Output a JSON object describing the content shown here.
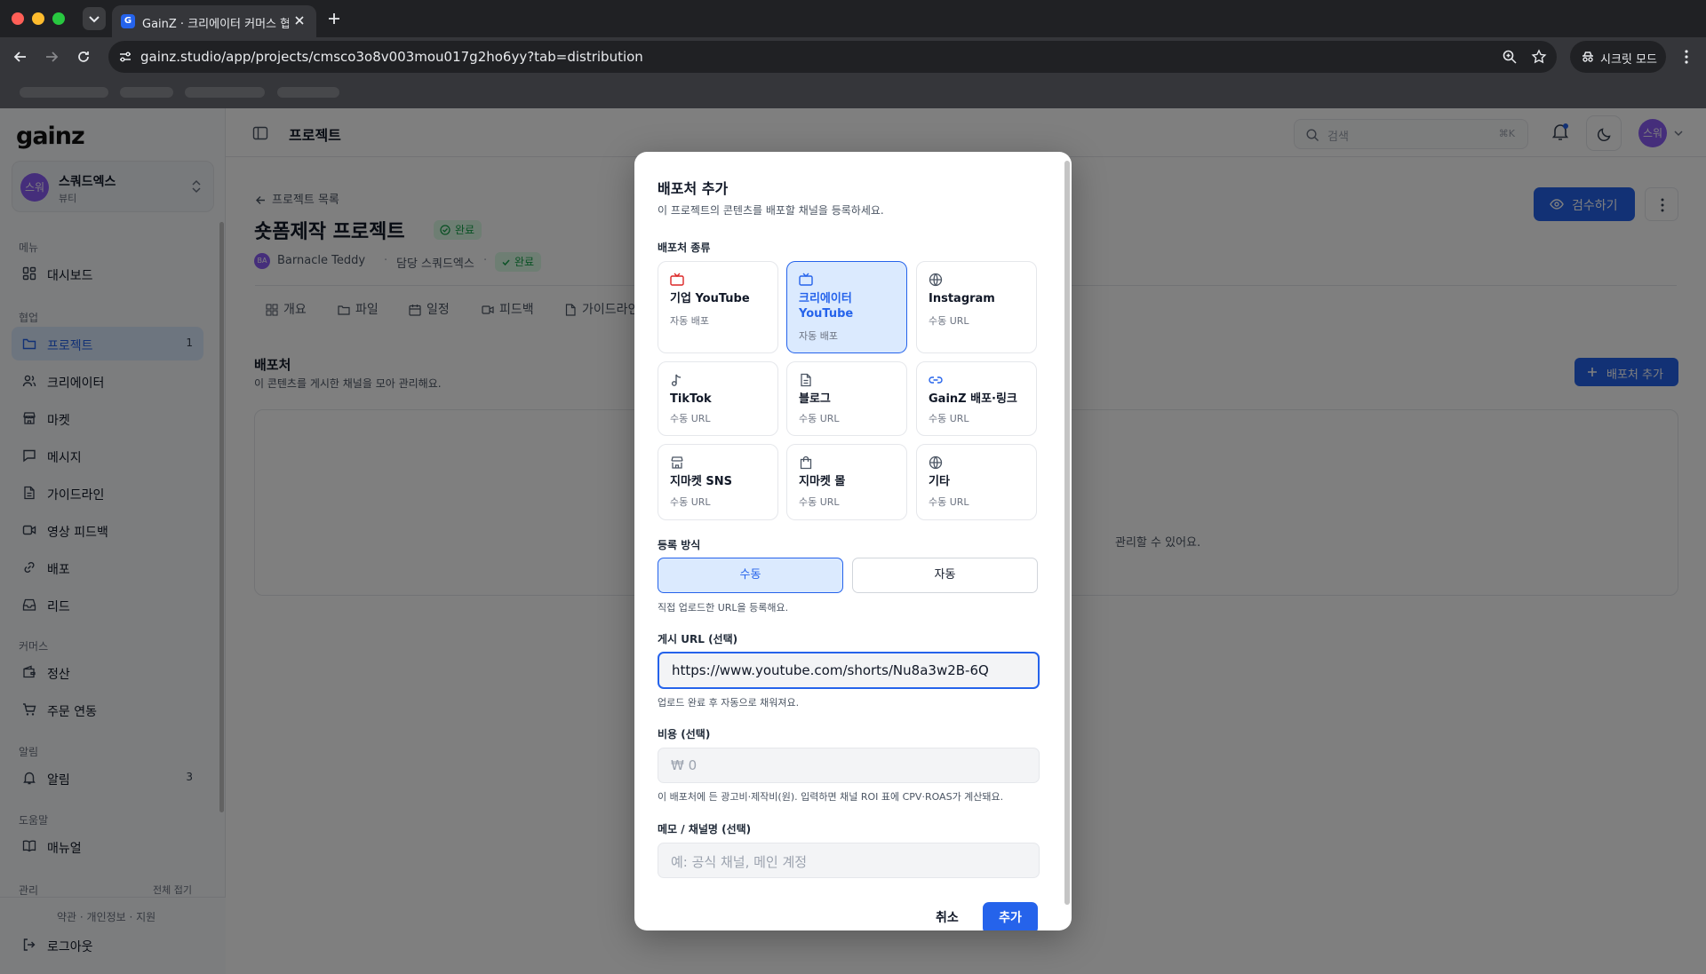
{
  "browser": {
    "tab_title": "GainZ · 크리에이터 커머스 협업 O",
    "tab_favicon": "G",
    "url": "gainz.studio/app/projects/cmsco3o8v003mou017g2ho6yy?tab=distribution",
    "incognito_label": "시크릿 모드"
  },
  "sidebar": {
    "logo": "gainz",
    "workspace": {
      "avatar": "스워",
      "name": "스쿼드엑스",
      "sub": "뷰티"
    },
    "sections": {
      "menu": "메뉴",
      "collab": "협업",
      "commerce": "커머스",
      "alerts": "알림",
      "help": "도움말",
      "admin": "관리",
      "collapse_all": "전체 접기"
    },
    "items": [
      {
        "label": "대시보드",
        "icon": "dashboard-icon"
      },
      {
        "label": "프로젝트",
        "icon": "folder-icon",
        "badge": "1"
      },
      {
        "label": "크리에이터",
        "icon": "users-icon"
      },
      {
        "label": "마켓",
        "icon": "store-icon"
      },
      {
        "label": "메시지",
        "icon": "message-icon"
      },
      {
        "label": "가이드라인",
        "icon": "document-icon"
      },
      {
        "label": "영상 피드백",
        "icon": "video-icon"
      },
      {
        "label": "배포",
        "icon": "link-icon"
      },
      {
        "label": "리드",
        "icon": "inbox-icon"
      },
      {
        "label": "정산",
        "icon": "wallet-icon"
      },
      {
        "label": "주문 연동",
        "icon": "cart-icon"
      },
      {
        "label": "알림",
        "icon": "bell-icon",
        "badge": "3"
      },
      {
        "label": "매뉴얼",
        "icon": "book-icon"
      }
    ],
    "footer_links": "약관 · 개인정보 · 지원",
    "logout": "로그아웃"
  },
  "topbar": {
    "title": "프로젝트",
    "search_placeholder": "검색",
    "search_shortcut": "⌘K",
    "avatar": "스워"
  },
  "page": {
    "back": "프로젝트 목록",
    "title": "숏폼제작 프로젝트",
    "status": "완료",
    "owner": "Barnacle Teddy",
    "owner_avatar": "BA",
    "manager": "담당 스쿼드엑스",
    "status2": "완료",
    "review_button": "검수하기",
    "tabs": [
      "개요",
      "파일",
      "일정",
      "피드백",
      "가이드라인"
    ],
    "section_title": "배포처",
    "section_sub": "이 콘텐츠를 게시한 채널을 모아 관리해요.",
    "add_button": "배포처 추가",
    "empty_text": "관리할 수 있어요."
  },
  "modal": {
    "title": "배포처 추가",
    "subtitle": "이 프로젝트의 콘텐츠를 배포할 채널을 등록하세요.",
    "type_label": "배포처 종류",
    "types": [
      {
        "name": "기업 YouTube",
        "sub": "자동 배포",
        "icon": "tv-icon",
        "selected": false
      },
      {
        "name": "크리에이터 YouTube",
        "sub": "자동 배포",
        "icon": "tv-icon",
        "selected": true
      },
      {
        "name": "Instagram",
        "sub": "수동 URL",
        "icon": "globe-icon",
        "selected": false
      },
      {
        "name": "TikTok",
        "sub": "수동 URL",
        "icon": "music-note-icon",
        "selected": false
      },
      {
        "name": "블로그",
        "sub": "수동 URL",
        "icon": "document-icon",
        "selected": false
      },
      {
        "name": "GainZ 배포·링크",
        "sub": "수동 URL",
        "icon": "link-icon",
        "selected": false
      },
      {
        "name": "지마켓 SNS",
        "sub": "수동 URL",
        "icon": "store-icon",
        "selected": false
      },
      {
        "name": "지마켓 몰",
        "sub": "수동 URL",
        "icon": "shopping-bag-icon",
        "selected": false
      },
      {
        "name": "기타",
        "sub": "수동 URL",
        "icon": "globe-icon",
        "selected": false
      }
    ],
    "method_label": "등록 방식",
    "method_manual": "수동",
    "method_auto": "자동",
    "method_selected": "수동",
    "method_help": "직접 업로드한 URL을 등록해요.",
    "url_label": "게시 URL (선택)",
    "url_value": "https://www.youtube.com/shorts/Nu8a3w2B-6Q",
    "url_help": "업로드 완료 후 자동으로 채워져요.",
    "cost_label": "비용 (선택)",
    "cost_placeholder": "₩ 0",
    "cost_help": "이 배포처에 든 광고비·제작비(원). 입력하면 채널 ROI 표에 CPV·ROAS가 계산돼요.",
    "memo_label": "메모 / 채널명 (선택)",
    "memo_placeholder": "예: 공식 채널, 메인 계정",
    "cancel": "취소",
    "submit": "추가"
  },
  "colors": {
    "accent": "#2563eb",
    "accent_light": "#dbeafe",
    "success": "#16a34a",
    "brand_red": "#dc2626",
    "avatar": "#8b5cf6"
  }
}
